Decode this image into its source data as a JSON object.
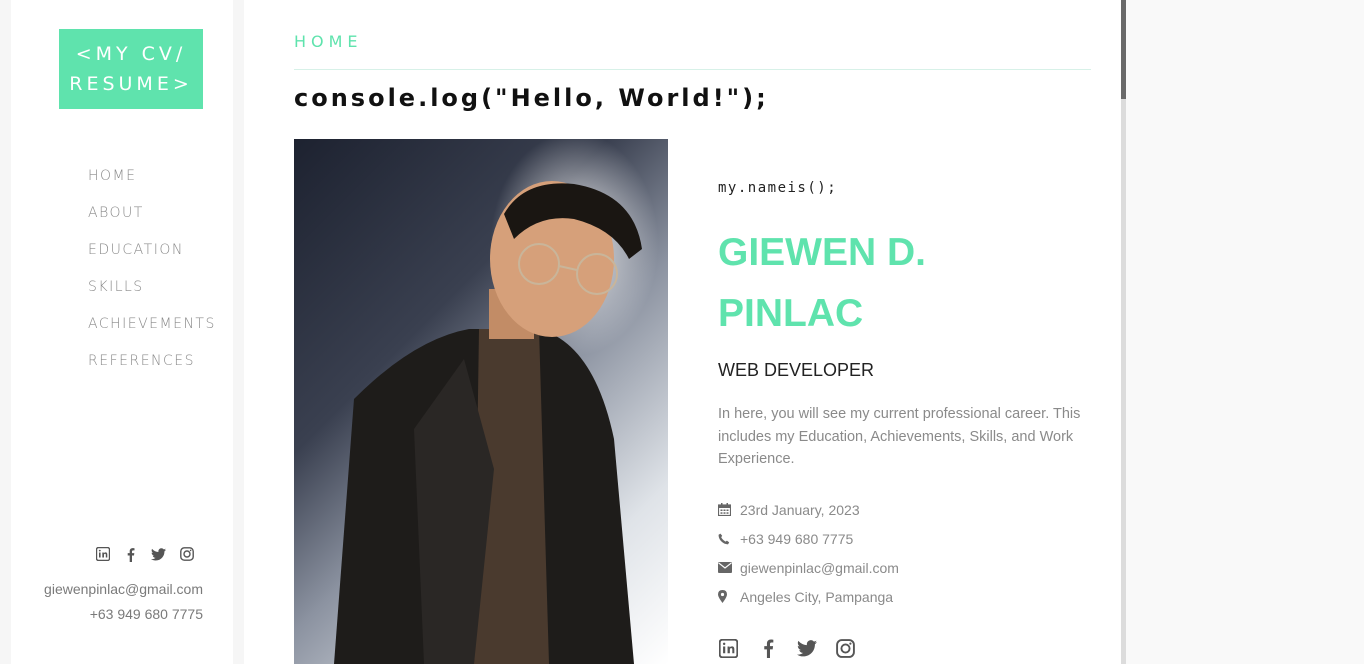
{
  "sidebar": {
    "logo": "<MY CV/ RESUME>",
    "nav": [
      "HOME",
      "ABOUT",
      "EDUCATION",
      "SKILLS",
      "ACHIEVEMENTS",
      "REFERENCES"
    ],
    "social_icons": [
      "linkedin-icon",
      "facebook-icon",
      "twitter-icon",
      "instagram-icon"
    ],
    "email": "giewenpinlac@gmail.com",
    "phone": "+63 949 680 7775"
  },
  "main": {
    "breadcrumb": "HOME",
    "headline": "console.log(\"Hello, World!\");",
    "prefix": "my.nameis();",
    "name_line1": "GIEWEN D.",
    "name_line2": "PINLAC",
    "role": "WEB DEVELOPER",
    "description": "In here, you will see my current professional career. This includes my Education, Achievements, Skills, and Work Experience.",
    "info": {
      "date": "23rd January, 2023",
      "phone": "+63 949 680 7775",
      "email": "giewenpinlac@gmail.com",
      "location": "Angeles City, Pampanga"
    },
    "social_icons": [
      "linkedin-icon",
      "facebook-icon",
      "twitter-icon",
      "instagram-icon"
    ]
  },
  "colors": {
    "accent": "#5fe3ad",
    "text": "#222222",
    "muted": "#8a8a8a"
  }
}
